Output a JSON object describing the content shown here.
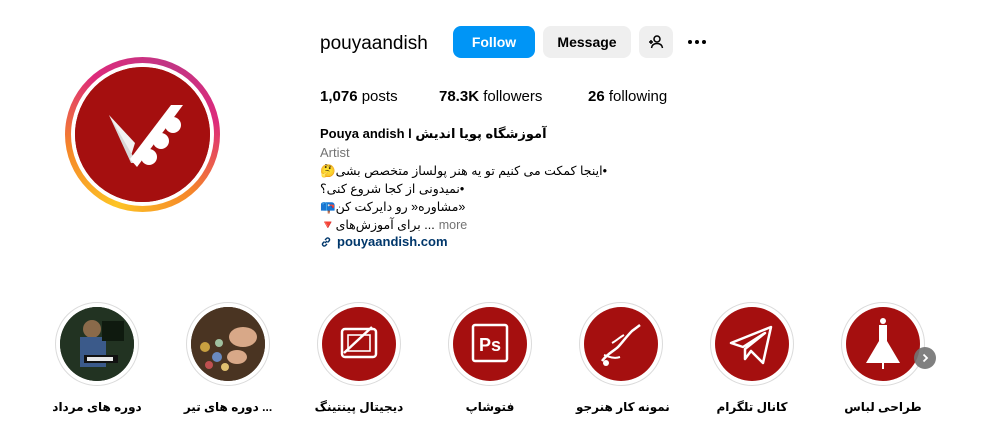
{
  "profile": {
    "username": "pouyaandish",
    "follow_label": "Follow",
    "message_label": "Message",
    "add_user_icon": "add-user-icon",
    "more_icon": "more-options-icon",
    "brand_color": "#a50f0f",
    "follow_color": "#0095f6"
  },
  "stats": {
    "posts_count": "1,076",
    "posts_label": "posts",
    "followers_count": "78.3K",
    "followers_label": "followers",
    "following_count": "26",
    "following_label": "following"
  },
  "bio": {
    "name": "Pouya andish l آموزشگاه پویا اندیش",
    "category": "Artist",
    "line1": "🤔اینجا کمکت می کنیم تو یه هنر پولساز متخصص بشی•",
    "line2": "نمیدونی از کجا شروع کنی؟•",
    "line3": "📪مشاوره« رو دایرکت کن»",
    "line4": "🔻برای آموزش‌های ...",
    "more_label": "more",
    "link": "pouyaandish.com",
    "link_icon": "link-icon"
  },
  "highlights": [
    {
      "label": "دوره های مرداد",
      "icon": "photo-thumbnail"
    },
    {
      "label": "دوره های تیر ...",
      "icon": "photo-thumbnail"
    },
    {
      "label": "دیجیتال پینتینگ",
      "icon": "tablet-icon"
    },
    {
      "label": "فتوشاپ",
      "icon": "photoshop-icon"
    },
    {
      "label": "نمونه کار هنرجو",
      "icon": "brush-hand-icon"
    },
    {
      "label": "کانال تلگرام",
      "icon": "telegram-icon"
    },
    {
      "label": "طراحی لباس",
      "icon": "dress-icon"
    }
  ],
  "highlights_next_icon": "chevron-right-icon"
}
